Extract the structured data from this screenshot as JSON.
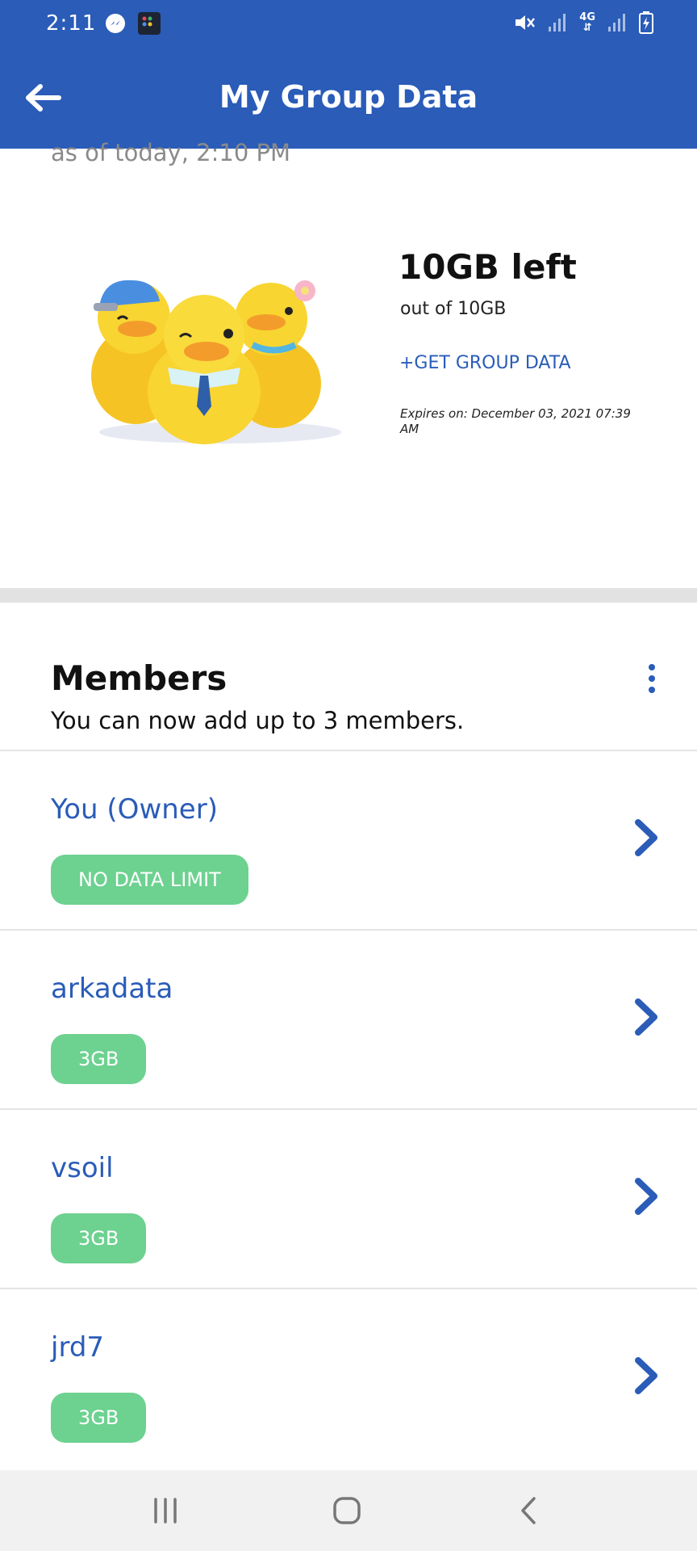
{
  "status_bar": {
    "time": "2:11",
    "network": "4G"
  },
  "header": {
    "title": "My Group Data"
  },
  "summary": {
    "as_of": "as of today, 2:10 PM",
    "left_amount": "10GB left",
    "out_of": "out of 10GB",
    "get_data_label": "+GET GROUP DATA",
    "expires": "Expires on: December 03, 2021 07:39 AM"
  },
  "members": {
    "title": "Members",
    "subtitle": "You can now add up to 3 members.",
    "list": [
      {
        "name": "You (Owner)",
        "limit": "NO DATA LIMIT"
      },
      {
        "name": "arkadata",
        "limit": "3GB"
      },
      {
        "name": "vsoil",
        "limit": "3GB"
      },
      {
        "name": "jrd7",
        "limit": "3GB"
      }
    ]
  },
  "colors": {
    "primary": "#2a5cb8",
    "badge": "#6dd190",
    "divider": "#e2e2e2"
  }
}
